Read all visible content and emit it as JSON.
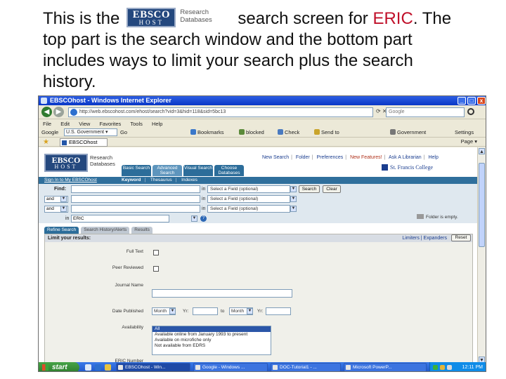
{
  "caption": {
    "pre": "This is the",
    "logo": {
      "line1": "EBSCO",
      "line2": "HOST",
      "word1": "Research",
      "word2": "Databases"
    },
    "mid": "search screen for ",
    "keyword": "ERIC",
    "post": ". The top part is the search window and the bottom part includes ways to limit your search plus the search history."
  },
  "colors": {
    "keyword": "#c0102a",
    "ebsco_blue": "#24487e",
    "xp_blue": "#0a37c6",
    "nav_teal": "#2f6f9c"
  },
  "browser": {
    "title": "EBSCOhost - Windows Internet Explorer",
    "window_buttons": [
      "_",
      "□",
      "x"
    ],
    "address": "http://web.ebscohost.com/ehost/search?vid=3&hid=118&sid=5bc13",
    "search_placeholder": "Google",
    "menu": [
      "File",
      "Edit",
      "View",
      "Favorites",
      "Tools",
      "Help"
    ],
    "toolbar": {
      "google": "Google",
      "gov_select": "U.S. Government ▾",
      "go": "Go",
      "bookmarks": "Bookmarks",
      "blocked": "blocked",
      "check": "Check",
      "send": "Send to",
      "gov": "Government",
      "settings": "Settings"
    },
    "tab": "EBSCOhost",
    "favbar_right": "Page ▾"
  },
  "ebsco": {
    "logo": {
      "line1": "EBSCO",
      "line2": "HOST",
      "word1": "Research",
      "word2": "Databases"
    },
    "top_links": [
      "New Search",
      "Folder",
      "Preferences",
      "New Features!",
      "Ask A Librarian",
      "Help"
    ],
    "college": "St. Francis College",
    "tabs": [
      "Basic Search",
      "Advanced Search",
      "Visual Search",
      "Choose Databases"
    ],
    "sign_in": "Sign In to My EBSCOhost",
    "subnav": [
      "Keyword",
      "Thesaurus",
      "Indexes"
    ],
    "find_label": "Find:",
    "in_label": "in",
    "field_placeholder": "Select a Field (optional)",
    "bool_value": "and",
    "search_btn": "Search",
    "clear_btn": "Clear",
    "db_label": "in",
    "db_value": "ERIC",
    "folder_note": "Folder is empty.",
    "result_tabs": [
      "Refine Search",
      "Search History/Alerts",
      "Results"
    ],
    "limit_heading": "Limit your results:",
    "limit_links": "Limiters | Expanders",
    "reset": "Reset",
    "limiters": {
      "full_text": "Full Text",
      "peer_reviewed": "Peer Reviewed",
      "journal_name": "Journal Name",
      "date_published": "Date Published",
      "month1": "Month",
      "yr1": "Yr:",
      "to": "to",
      "month2": "Month",
      "yr2": "Yr:",
      "availability": "Availability",
      "eric_number": "ERIC Number"
    },
    "availability_options": [
      "All",
      "Available online from January 1993 to present",
      "Available on microfiche only",
      "Not available from EDRS"
    ]
  },
  "taskbar": {
    "start": "start",
    "tasks": [
      "EBSCOhost - Win...",
      "Google - Windows ...",
      "DOC-Tutorial1 - ...",
      "Microsoft PowerP..."
    ],
    "clock": "12:11 PM"
  }
}
